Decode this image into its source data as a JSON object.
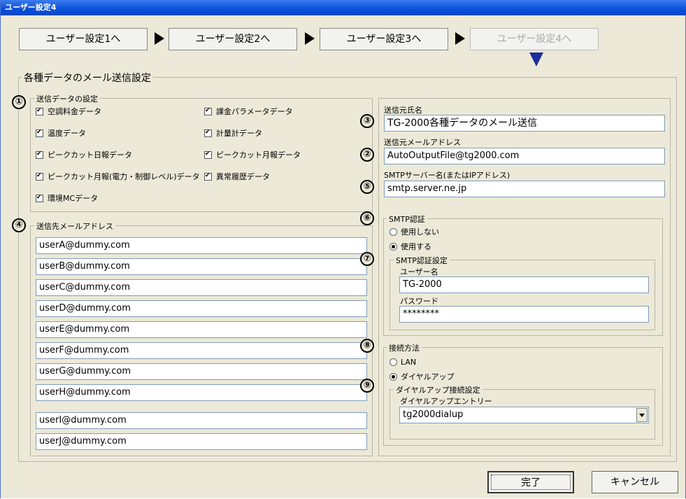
{
  "window": {
    "title": "ユーザー設定4"
  },
  "nav": {
    "buttons": [
      {
        "label": "ユーザー設定1へ"
      },
      {
        "label": "ユーザー設定2へ"
      },
      {
        "label": "ユーザー設定3へ"
      },
      {
        "label": "ユーザー設定4へ",
        "disabled": true
      }
    ]
  },
  "main_group": {
    "label": "各種データのメール送信設定"
  },
  "callouts": [
    "①",
    "②",
    "③",
    "④",
    "⑤",
    "⑥",
    "⑦",
    "⑧",
    "⑨"
  ],
  "send_data": {
    "label": "送信データの設定",
    "items": [
      {
        "label": "空調料金データ",
        "checked": true
      },
      {
        "label": "課金パラメータデータ",
        "checked": true
      },
      {
        "label": "温度データ",
        "checked": true
      },
      {
        "label": "計量計データ",
        "checked": true
      },
      {
        "label": "ピークカット日報データ",
        "checked": true
      },
      {
        "label": "ピークカット月報データ",
        "checked": true
      },
      {
        "label": "ピークカット月報(電力・制御レベル)データ",
        "checked": true
      },
      {
        "label": "異常履歴データ",
        "checked": true
      },
      {
        "label": "環境MCデータ",
        "checked": true
      }
    ]
  },
  "recipients": {
    "label": "送信先メールアドレス",
    "addresses": [
      "userA@dummy.com",
      "userB@dummy.com",
      "userC@dummy.com",
      "userD@dummy.com",
      "userE@dummy.com",
      "userF@dummy.com",
      "userG@dummy.com",
      "userH@dummy.com",
      "userI@dummy.com",
      "userJ@dummy.com"
    ]
  },
  "sender": {
    "name_label": "送信元氏名",
    "name_value": "TG-2000各種データのメール送信",
    "address_label": "送信元メールアドレス",
    "address_value": "AutoOutputFile@tg2000.com",
    "smtp_label": "SMTPサーバー名(またはIPアドレス)",
    "smtp_value": "smtp.server.ne.jp"
  },
  "smtp_auth": {
    "label": "SMTP認証",
    "option_off": "使用しない",
    "option_on": "使用する",
    "selected": "on",
    "settings_label": "SMTP認証設定",
    "user_label": "ユーザー名",
    "user_value": "TG-2000",
    "password_label": "パスワード",
    "password_value": "********"
  },
  "connection": {
    "label": "接続方法",
    "option_lan": "LAN",
    "option_dialup": "ダイヤルアップ",
    "selected": "dialup",
    "dialup_settings_label": "ダイヤルアップ接続設定",
    "entry_label": "ダイヤルアップエントリー",
    "entry_value": "tg2000dialup"
  },
  "footer": {
    "ok_label": "完了",
    "cancel_label": "キャンセル"
  }
}
